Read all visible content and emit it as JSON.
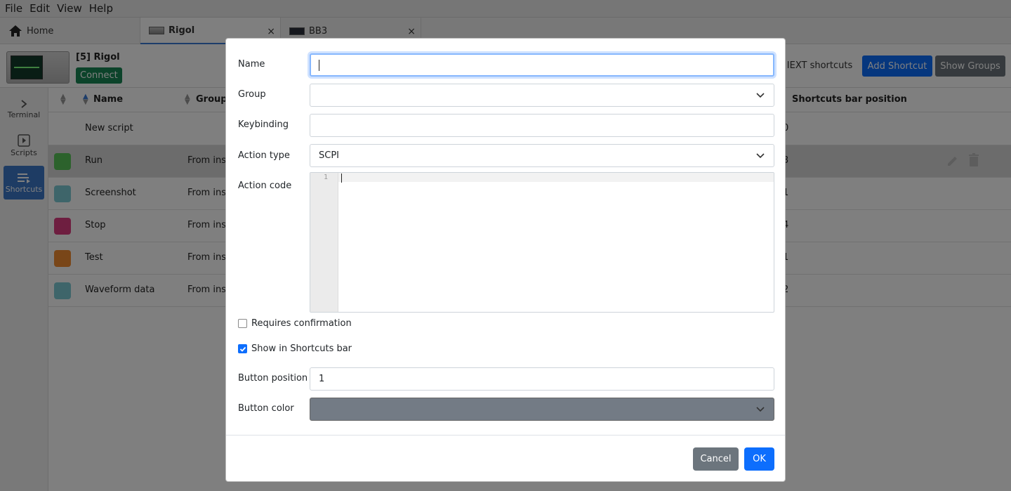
{
  "menu": [
    "File",
    "Edit",
    "View",
    "Help"
  ],
  "tabs": [
    {
      "label": "Home",
      "icon": "home-icon",
      "closable": false,
      "active": false
    },
    {
      "label": "Rigol",
      "icon": "instrument-thumbnail",
      "closable": true,
      "active": true
    },
    {
      "label": "BB3",
      "icon": "instrument-thumbnail",
      "closable": true,
      "active": false
    }
  ],
  "tab_close_glyph": "×",
  "instrument": {
    "name": "[5] Rigol",
    "connect_label": "Connect",
    "connect_color": "#198754"
  },
  "toolbar": {
    "iext_label": "w IEXT shortcuts",
    "add_shortcut_label": "Add Shortcut",
    "show_groups_label": "Show Groups",
    "accent": "#0d6efd",
    "secondary": "#6c757d"
  },
  "nav": [
    {
      "label": "Terminal",
      "icon": "chevron-right-icon",
      "active": false
    },
    {
      "label": "Scripts",
      "icon": "play-icon",
      "active": false
    },
    {
      "label": "Shortcuts",
      "icon": "shortcuts-icon",
      "active": true
    }
  ],
  "table": {
    "headers": {
      "name": "Name",
      "group": "Group /",
      "position": "Shortcuts bar position"
    },
    "rows": [
      {
        "name": "New script",
        "group": "",
        "position": "0",
        "color": "",
        "selected": false
      },
      {
        "name": "Run",
        "group": "From inst",
        "position": "3",
        "color": "#58c558",
        "selected": true
      },
      {
        "name": "Screenshot",
        "group": "From inst",
        "position": "1",
        "color": "#7ccbd5",
        "selected": false
      },
      {
        "name": "Stop",
        "group": "From inst",
        "position": "4",
        "color": "#dc3c80",
        "selected": false
      },
      {
        "name": "Test",
        "group": "From inst",
        "position": "1",
        "color": "#f28c30",
        "selected": false
      },
      {
        "name": "Waveform data",
        "group": "From inst",
        "position": "2",
        "color": "#7ccbd5",
        "selected": false
      }
    ]
  },
  "dialog": {
    "name_label": "Name",
    "name_value": "",
    "group_label": "Group",
    "group_value": "",
    "keybinding_label": "Keybinding",
    "keybinding_value": "",
    "action_type_label": "Action type",
    "action_type_value": "SCPI",
    "action_code_label": "Action code",
    "editor_line_number": "1",
    "requires_confirmation_label": "Requires confirmation",
    "requires_confirmation_checked": false,
    "show_in_bar_label": "Show in Shortcuts bar",
    "show_in_bar_checked": true,
    "button_position_label": "Button position",
    "button_position_value": "1",
    "button_color_label": "Button color",
    "button_color_value": "#737b85",
    "cancel_label": "Cancel",
    "ok_label": "OK"
  }
}
